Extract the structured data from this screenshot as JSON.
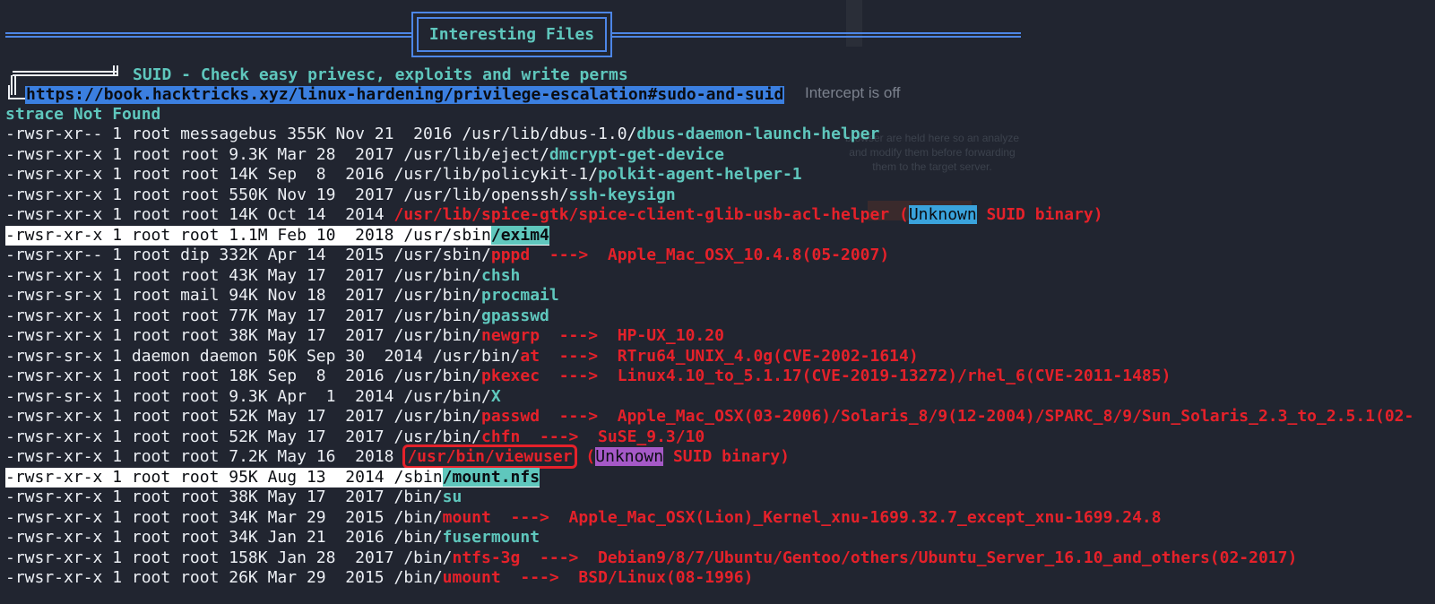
{
  "header": {
    "banner_title": "Interesting Files"
  },
  "background_window": {
    "title": "Intercept is off",
    "description": "browser are held here so an analyze and modify them before forwarding them to the target server."
  },
  "section": {
    "title": "SUID - Check easy privesc, exploits and write perms",
    "link": "https://book.hacktricks.xyz/linux-hardening/privilege-escalation#sudo-and-suid",
    "note": "strace Not Found"
  },
  "rows": [
    {
      "prefix": "-rwsr-xr-- 1 root messagebus 355K Nov 21  2016 /usr/lib/dbus-1.0/",
      "name": "dbus-daemon-launch-helper",
      "suffix": ""
    },
    {
      "prefix": "-rwsr-xr-x 1 root root 9.3K Mar 28  2017 /usr/lib/eject/",
      "name": "dmcrypt-get-device",
      "suffix": ""
    },
    {
      "prefix": "-rwsr-xr-x 1 root root 14K Sep  8  2016 /usr/lib/policykit-1/",
      "name": "polkit-agent-helper-1",
      "suffix": ""
    },
    {
      "prefix": "-rwsr-xr-x 1 root root 550K Nov 19  2017 /usr/lib/openssh/",
      "name": "ssh-keysign",
      "suffix": ""
    },
    {
      "prefix": "-rwsr-xr-x 1 root root 14K Oct 14  2014 ",
      "red": "/usr/lib/spice-gtk/spice-client-glib-usb-acl-helper (",
      "badge": "Unknown",
      "after": " SUID binary)"
    },
    {
      "prefix": "-rwsr-xr-x 1 root root 1.1M Feb 10  2018 /usr/sbin",
      "name": "/exim4",
      "highlight": true
    },
    {
      "prefix": "-rwsr-xr-- 1 root dip 332K Apr 14  2015 /usr/sbin/",
      "red": "pppd  --->  Apple_Mac_OSX_10.4.8(05-2007)"
    },
    {
      "prefix": "-rwsr-xr-x 1 root root 43K May 17  2017 /usr/bin/",
      "name": "chsh"
    },
    {
      "prefix": "-rwsr-sr-x 1 root mail 94K Nov 18  2017 /usr/bin/",
      "name": "procmail"
    },
    {
      "prefix": "-rwsr-xr-x 1 root root 77K May 17  2017 /usr/bin/",
      "name": "gpasswd"
    },
    {
      "prefix": "-rwsr-xr-x 1 root root 38K May 17  2017 /usr/bin/",
      "red": "newgrp  --->  HP-UX_10.20"
    },
    {
      "prefix": "-rwsr-sr-x 1 daemon daemon 50K Sep 30  2014 /usr/bin/",
      "red": "at  --->  RTru64_UNIX_4.0g(CVE-2002-1614)"
    },
    {
      "prefix": "-rwsr-xr-x 1 root root 18K Sep  8  2016 /usr/bin/",
      "red": "pkexec  --->  Linux4.10_to_5.1.17(CVE-2019-13272)/rhel_6(CVE-2011-1485)"
    },
    {
      "prefix": "-rwsr-sr-x 1 root root 9.3K Apr  1  2014 /usr/bin/",
      "name": "X"
    },
    {
      "prefix": "-rwsr-xr-x 1 root root 52K May 17  2017 /usr/bin/",
      "red": "passwd  --->  Apple_Mac_OSX(03-2006)/Solaris_8/9(12-2004)/SPARC_8/9/Sun_Solaris_2.3_to_2.5.1(02-"
    },
    {
      "prefix": "-rwsr-xr-x 1 root root 52K May 17  2017 /usr/bin/",
      "red": "chfn  --->  SuSE_9.3/10"
    },
    {
      "prefix": "-rwsr-xr-x 1 root root 7.2K May 16  2018 ",
      "boxed": "/usr/bin/viewuser",
      "red": " (",
      "badge": "Unknown",
      "after": " SUID binary)",
      "purple": true
    },
    {
      "prefix": "-rwsr-xr-x 1 root root 95K Aug 13  2014 /sbin",
      "name": "/mount.nfs",
      "highlight": true
    },
    {
      "prefix": "-rwsr-xr-x 1 root root 38K May 17  2017 /bin/",
      "name": "su"
    },
    {
      "prefix": "-rwsr-xr-x 1 root root 34K Mar 29  2015 /bin/",
      "red": "mount  --->  Apple_Mac_OSX(Lion)_Kernel_xnu-1699.32.7_except_xnu-1699.24.8"
    },
    {
      "prefix": "-rwsr-xr-x 1 root root 34K Jan 21  2016 /bin/",
      "name": "fusermount"
    },
    {
      "prefix": "-rwsr-xr-x 1 root root 158K Jan 28  2017 /bin/",
      "red": "ntfs-3g  --->  Debian9/8/7/Ubuntu/Gentoo/others/Ubuntu_Server_16.10_and_others(02-2017)"
    },
    {
      "prefix": "-rwsr-xr-x 1 root root 26K Mar 29  2015 /bin/",
      "red": "umount  --->  BSD/Linux(08-1996)"
    }
  ]
}
